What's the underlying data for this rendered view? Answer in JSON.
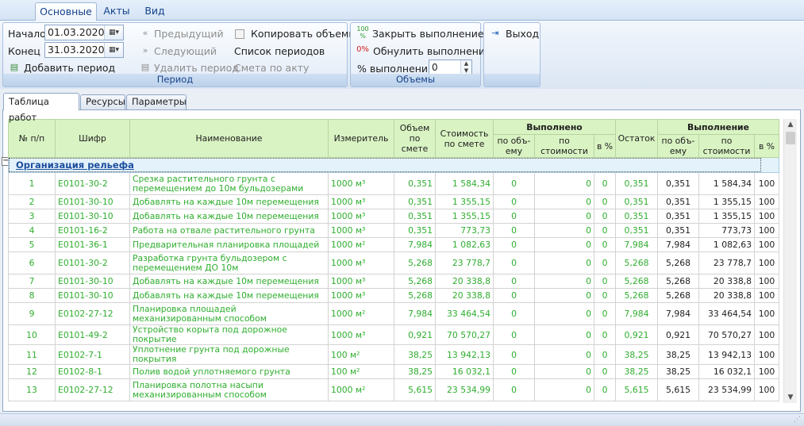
{
  "ribbon_tabs": [
    "Основные",
    "Акты",
    "Вид"
  ],
  "period": {
    "start_label": "Начало",
    "start_value": "01.03.2020",
    "end_label": "Конец",
    "end_value": "31.03.2020",
    "add_period": "Добавить период",
    "prev": "Предыдущий",
    "next": "Следующий",
    "delete_period": "Удалить период",
    "copy_volumes": "Копировать объемы",
    "period_list": "Список периодов",
    "estimate_by_act": "Смета по акту",
    "group_title": "Период"
  },
  "volumes": {
    "close_exec": "Закрыть выполнение",
    "close_icon_text": "100 %",
    "reset_exec": "Обнулить выполнение",
    "reset_icon_text": "0%",
    "pct_label": "% выполнения",
    "pct_value": "0",
    "group_title": "Объемы"
  },
  "exit_label": "Выход",
  "panel_tabs": [
    "Таблица работ",
    "Ресурсы",
    "Параметры"
  ],
  "columns": {
    "num": "№ п/п",
    "code": "Шифр",
    "name": "Наименование",
    "unit": "Измеритель",
    "vol_est": "Объем по смете",
    "cost_est": "Стоимость по смете",
    "done": "Выполнено",
    "done_vol": "по объ-ему",
    "done_cost": "по стоимости",
    "done_pct": "в %",
    "rest": "Остаток",
    "exec": "Выполнение",
    "exec_vol": "по объ-ему",
    "exec_cost": "по стоимости",
    "exec_pct": "в %"
  },
  "group_name": "Организация рельефа",
  "rows": [
    {
      "n": "1",
      "code": "Е0101-30-2",
      "name": "Срезка растительного грунта с перемещением до 10м бульдозерами",
      "unit": "1000 м³",
      "vol": "0,351",
      "cost": "1 584,34",
      "dv": "0",
      "dc": "0",
      "dp": "0",
      "rest": "0,351",
      "ev": "0,351",
      "ec": "1 584,34",
      "ep": "100"
    },
    {
      "n": "2",
      "code": "Е0101-30-10",
      "name": "Добавлять на каждые 10м перемещения",
      "unit": "1000 м³",
      "vol": "0,351",
      "cost": "1 355,15",
      "dv": "0",
      "dc": "0",
      "dp": "0",
      "rest": "0,351",
      "ev": "0,351",
      "ec": "1 355,15",
      "ep": "100"
    },
    {
      "n": "3",
      "code": "Е0101-30-10",
      "name": "Добавлять на каждые 10м перемещения",
      "unit": "1000 м³",
      "vol": "0,351",
      "cost": "1 355,15",
      "dv": "0",
      "dc": "0",
      "dp": "0",
      "rest": "0,351",
      "ev": "0,351",
      "ec": "1 355,15",
      "ep": "100"
    },
    {
      "n": "4",
      "code": "Е0101-16-2",
      "name": "Работа на отвале растительного грунта",
      "unit": "1000 м³",
      "vol": "0,351",
      "cost": "773,73",
      "dv": "0",
      "dc": "0",
      "dp": "0",
      "rest": "0,351",
      "ev": "0,351",
      "ec": "773,73",
      "ep": "100"
    },
    {
      "n": "5",
      "code": "Е0101-36-1",
      "name": "Предварительная планировка площадей",
      "unit": "1000 м²",
      "vol": "7,984",
      "cost": "1 082,63",
      "dv": "0",
      "dc": "0",
      "dp": "0",
      "rest": "7,984",
      "ev": "7,984",
      "ec": "1 082,63",
      "ep": "100"
    },
    {
      "n": "6",
      "code": "Е0101-30-2",
      "name": "Разработка грунта бульдозером с перемещением ДО 10м",
      "unit": "1000 м³",
      "vol": "5,268",
      "cost": "23 778,7",
      "dv": "0",
      "dc": "0",
      "dp": "0",
      "rest": "5,268",
      "ev": "5,268",
      "ec": "23 778,7",
      "ep": "100"
    },
    {
      "n": "7",
      "code": "Е0101-30-10",
      "name": "Добавлять на каждые 10м перемещения",
      "unit": "1000 м³",
      "vol": "5,268",
      "cost": "20 338,8",
      "dv": "0",
      "dc": "0",
      "dp": "0",
      "rest": "5,268",
      "ev": "5,268",
      "ec": "20 338,8",
      "ep": "100"
    },
    {
      "n": "8",
      "code": "Е0101-30-10",
      "name": "Добавлять на каждые 10м перемещения",
      "unit": "1000 м³",
      "vol": "5,268",
      "cost": "20 338,8",
      "dv": "0",
      "dc": "0",
      "dp": "0",
      "rest": "5,268",
      "ev": "5,268",
      "ec": "20 338,8",
      "ep": "100"
    },
    {
      "n": "9",
      "code": "Е0102-27-12",
      "name": "Планировка площадей механизированным способом",
      "unit": "1000 м²",
      "vol": "7,984",
      "cost": "33 464,54",
      "dv": "0",
      "dc": "0",
      "dp": "0",
      "rest": "7,984",
      "ev": "7,984",
      "ec": "33 464,54",
      "ep": "100"
    },
    {
      "n": "10",
      "code": "Е0101-49-2",
      "name": "Устройство корыта под дорожное покрытие",
      "unit": "1000 м³",
      "vol": "0,921",
      "cost": "70 570,27",
      "dv": "0",
      "dc": "0",
      "dp": "0",
      "rest": "0,921",
      "ev": "0,921",
      "ec": "70 570,27",
      "ep": "100"
    },
    {
      "n": "11",
      "code": "Е0102-7-1",
      "name": "Уплотнение грунта под дорожные покрытия",
      "unit": "100 м²",
      "vol": "38,25",
      "cost": "13 942,13",
      "dv": "0",
      "dc": "0",
      "dp": "0",
      "rest": "38,25",
      "ev": "38,25",
      "ec": "13 942,13",
      "ep": "100"
    },
    {
      "n": "12",
      "code": "Е0102-8-1",
      "name": "Полив водой уплотняемого грунта",
      "unit": "100 м²",
      "vol": "38,25",
      "cost": "16 032,1",
      "dv": "0",
      "dc": "0",
      "dp": "0",
      "rest": "38,25",
      "ev": "38,25",
      "ec": "16 032,1",
      "ep": "100"
    },
    {
      "n": "13",
      "code": "Е0102-27-12",
      "name": "Планировка полотна насыпи механизированным способом",
      "unit": "1000 м²",
      "vol": "5,615",
      "cost": "23 534,99",
      "dv": "0",
      "dc": "0",
      "dp": "0",
      "rest": "5,615",
      "ev": "5,615",
      "ec": "23 534,99",
      "ep": "100"
    }
  ]
}
